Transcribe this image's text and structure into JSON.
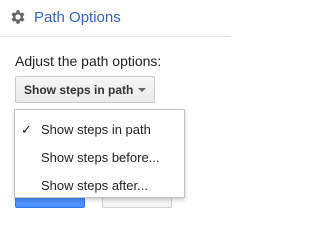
{
  "header": {
    "title": "Path Options",
    "icon": "gear-icon"
  },
  "prompt": "Adjust the path options:",
  "select": {
    "selected_label": "Show steps in path",
    "arrow_icon": "chevron-down-icon"
  },
  "menu": {
    "items": [
      {
        "label": "Show steps in path",
        "checked": true
      },
      {
        "label": "Show steps before..."
      },
      {
        "label": "Show steps after..."
      }
    ],
    "check_icon": "checkmark-icon"
  },
  "colors": {
    "title": "#3366cc",
    "primary_button": "#4d90fe"
  }
}
